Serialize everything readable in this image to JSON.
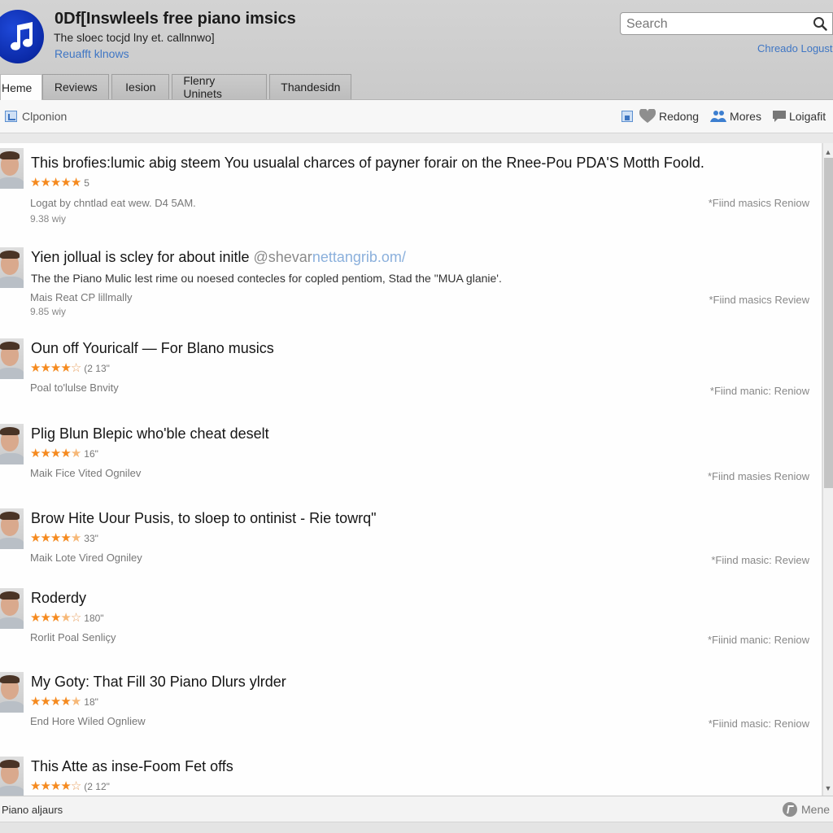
{
  "header": {
    "title": "0Df[Inswleels free piano imsics",
    "subtitle": "The sloec tocjd lny et. callnnwo]",
    "link": "Reuafft klnows",
    "logo_icon": "music-note-icon",
    "search_placeholder": "Search",
    "account_link": "Chreado Logust"
  },
  "tabs": [
    {
      "label": "Heme",
      "active": true
    },
    {
      "label": "Reviews",
      "active": false
    },
    {
      "label": "Iesion",
      "active": false
    },
    {
      "label": "Flenry Uninets",
      "active": false
    },
    {
      "label": "Thandesidn",
      "active": false
    }
  ],
  "toolbar": {
    "left_label": "Clponion",
    "right_items": [
      {
        "icon": "bookmark-icon",
        "label": ""
      },
      {
        "icon": "heart-icon",
        "label": "Redong"
      },
      {
        "icon": "users-icon",
        "label": "Mores"
      },
      {
        "icon": "comment-icon",
        "label": "Loigafit"
      }
    ]
  },
  "reviews": [
    {
      "title": "This brofies:lumic abig steem You usualal charces of payner forair on the Rnee-Pou PDA'S Motth Foold.",
      "stars": 5,
      "count": "5",
      "meta": "Logat by chntlad eat wew. D4 5AM.",
      "meta2": "9.38 wiy",
      "link": "*Fiind masics Reniow"
    },
    {
      "title": "Yien jollual is scley for about initle",
      "handle": "@shevar",
      "url": "nettangrib.om/",
      "desc": "The the Piano Mulic lest rime ou noesed contecles for copled pentiom, Stad the \"MUA glanie'.",
      "meta": "Mais Reat CP lillmally",
      "meta2": "9.85 wiy",
      "link": "*Fiind masics Review"
    },
    {
      "title": "Oun off Youricalf — For Blano musics",
      "stars": 4,
      "count": "(2 13\"",
      "meta": "Poal to'lulse Bnvity",
      "link": "*Fiind manic: Reniow"
    },
    {
      "title": "Plig Blun Blepic who'ble cheat deselt",
      "stars": 4.5,
      "count": "16\"",
      "meta": "Maik Fice Vited Ognilev",
      "link": "*Fiind masies Reniow"
    },
    {
      "title": "Brow Hite Uour Pusis, to sloep to ontinist - Rie towrq\"",
      "stars": 4.5,
      "count": "33\"",
      "meta": "Maik Lote Vired Ogniley",
      "link": "*Fiind masic: Review"
    },
    {
      "title": "Roderdy",
      "stars": 3.5,
      "count": "180\"",
      "meta": "Rorlit Poal Senliçy",
      "link": "*Fiinid manic: Reniow"
    },
    {
      "title": "My Goty: That Fill 30 Piano Dlurs ylrder",
      "stars": 4.5,
      "count": "18\"",
      "meta": "End Hore Wiled Ognliew",
      "link": "*Fiinid masic: Reniow"
    },
    {
      "title": "This Atte as inse-Foom Fet offs",
      "stars": 4,
      "count": "(2 12\"",
      "meta": "",
      "link": ""
    }
  ],
  "scrollbar": {
    "position_fraction": 0.0,
    "visible_fraction": 0.53
  },
  "status": {
    "left": "Piano aljaurs",
    "right": "Mene",
    "right_icon": "more-icon"
  },
  "colors": {
    "accent_link": "#3f76c4",
    "star": "#f58a1f",
    "logo": "#0b2aa8"
  }
}
